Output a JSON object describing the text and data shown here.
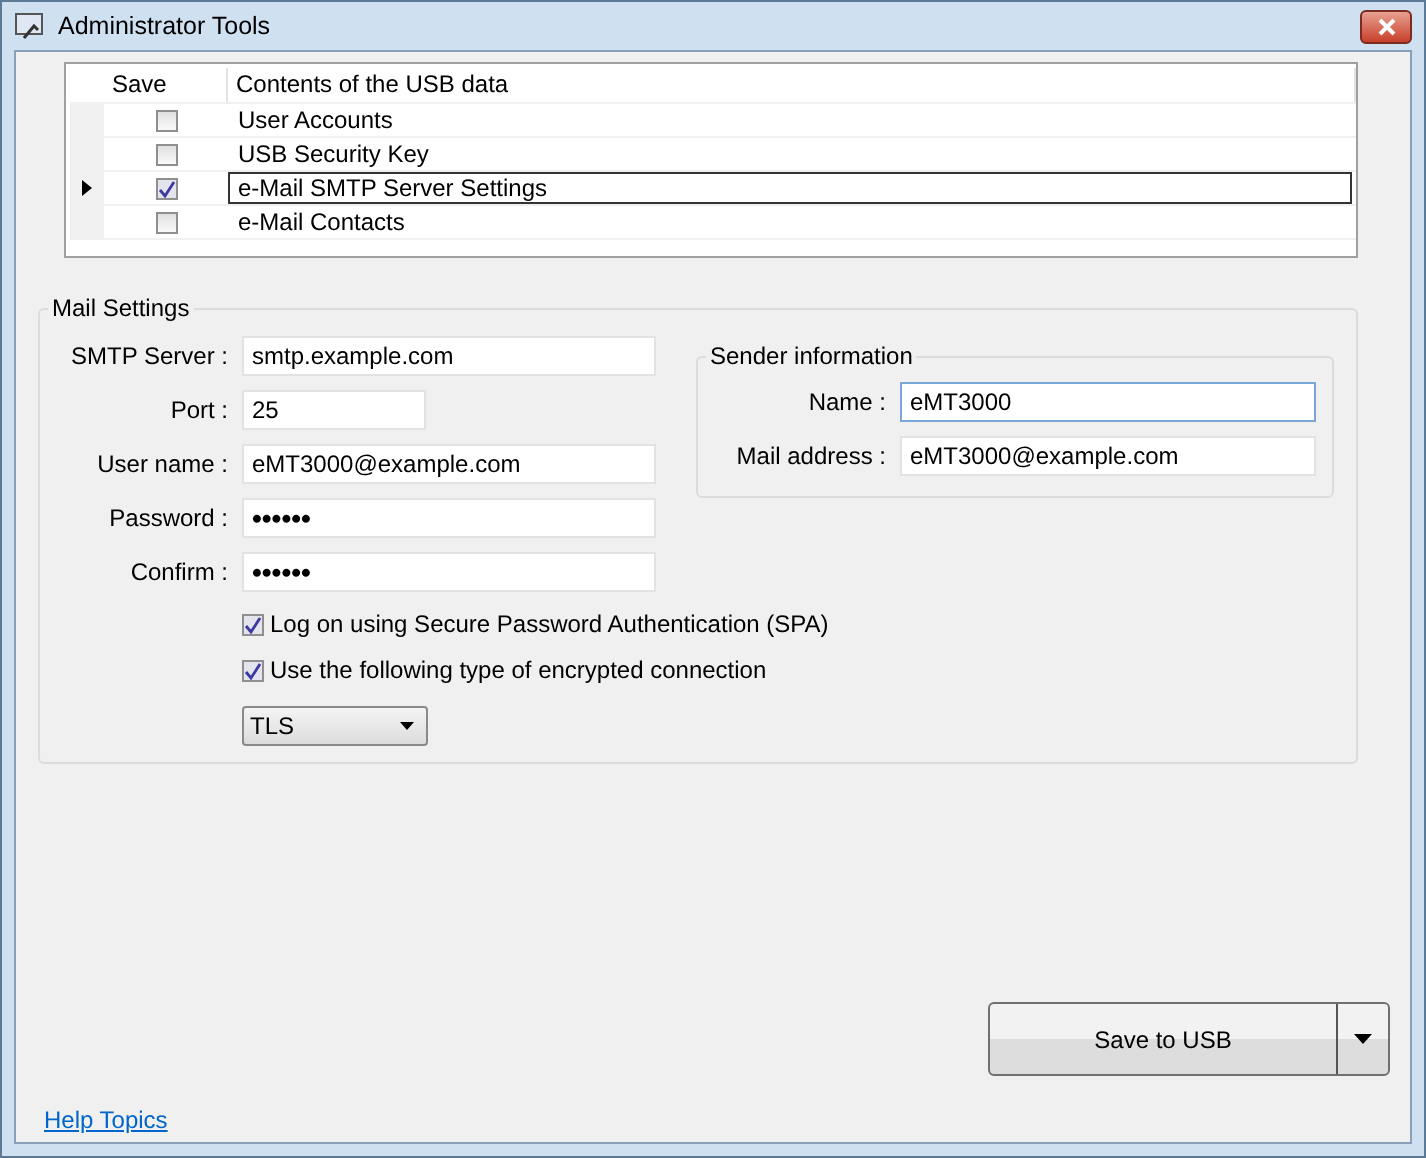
{
  "window": {
    "title": "Administrator Tools"
  },
  "table": {
    "columns": [
      "Save",
      "Contents of the USB data"
    ],
    "rows": [
      {
        "checked": false,
        "selected": false,
        "label": "User Accounts"
      },
      {
        "checked": false,
        "selected": false,
        "label": "USB Security Key"
      },
      {
        "checked": true,
        "selected": true,
        "label": "e-Mail SMTP Server Settings"
      },
      {
        "checked": false,
        "selected": false,
        "label": "e-Mail Contacts"
      }
    ]
  },
  "mail_settings": {
    "title": "Mail Settings",
    "fields": [
      {
        "label": "SMTP Server :",
        "value": "smtp.example.com",
        "kind": "wide"
      },
      {
        "label": "Port :",
        "value": "25",
        "kind": "short"
      },
      {
        "label": "User name :",
        "value": "eMT3000@example.com",
        "kind": "wide"
      },
      {
        "label": "Password :",
        "value": "••••••",
        "kind": "password"
      },
      {
        "label": "Confirm :",
        "value": "••••••",
        "kind": "password"
      }
    ],
    "options": [
      {
        "label": "Log on using Secure Password Authentication (SPA)",
        "checked": true
      },
      {
        "label": "Use the following type of encrypted connection",
        "checked": true
      }
    ],
    "encryption": {
      "value": "TLS"
    },
    "sender": {
      "title": "Sender information",
      "fields": [
        {
          "label": "Name :",
          "value": "eMT3000",
          "focused": true
        },
        {
          "label": "Mail address :",
          "value": "eMT3000@example.com",
          "focused": false
        }
      ]
    }
  },
  "save_button": {
    "label": "Save to USB"
  },
  "help_link": "Help Topics"
}
